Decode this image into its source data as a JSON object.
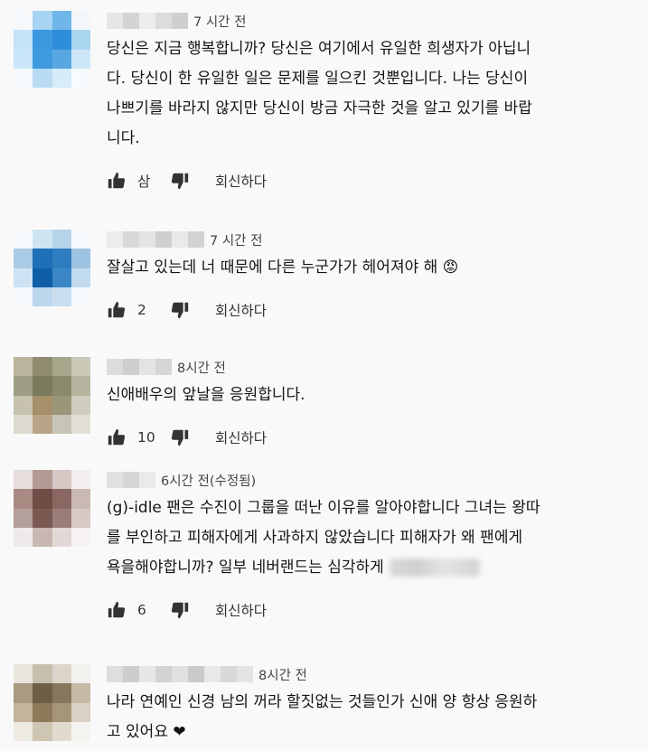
{
  "comments": [
    {
      "time": "7 시간 전",
      "lines": [
        "당신은 지금 행복합니까? 당신은 여기에서 유일한 희생자가 아닙니",
        "다. 당신이 한 유일한 일은 문제를 일으킨 것뿐입니다. 나는 당신이",
        "나쁘기를 바라지 않지만 당신이 방금 자극한 것을 알고 있기를 바랍",
        "니다."
      ],
      "likes": "삼",
      "reply": "회신하다",
      "avatar_colors": [
        "#f6f9fb",
        "#a6d4f2",
        "#6fb7e8",
        "#f3f7fa",
        "#c4e3f6",
        "#3b98de",
        "#2f8ed9",
        "#a9d5f1",
        "#c8e6f7",
        "#3f9be0",
        "#59a7e2",
        "#cde7f7",
        "#f7fafc",
        "#b9dcf3",
        "#d6ecf8",
        "#f8fbfd"
      ],
      "name_colors": [
        "#e6e6e6",
        "#d4d4d4",
        "#ececec",
        "#dcdcdc",
        "#cfcfcf"
      ]
    },
    {
      "time": "7 시간 전",
      "lines": [
        "잘살고 있는데 너 때문에 다른 누군가가 헤어져야 해 😡"
      ],
      "likes": "2",
      "reply": "회신하다",
      "avatar_colors": [
        "#f7fafc",
        "#cfe4f3",
        "#b6d4ea",
        "#f6f9fb",
        "#a9cbe6",
        "#1e70b8",
        "#2f7dc0",
        "#9dc3e3",
        "#cde2f2",
        "#0f5ea9",
        "#3a86c6",
        "#c2dbef",
        "#f6f9fc",
        "#bcd6ec",
        "#c9dff0",
        "#f7fafc"
      ],
      "name_colors": [
        "#ececec",
        "#d9d9d9",
        "#e4e4e4",
        "#cfcfcf",
        "#e9e9e9",
        "#d2d2d2"
      ]
    },
    {
      "time": "8시간 전",
      "lines": [
        "신애배우의 앞날을 응원합니다."
      ],
      "likes": "10",
      "reply": "회신하다",
      "avatar_colors": [
        "#b9b49c",
        "#8f8c72",
        "#a5a68a",
        "#c9c8b6",
        "#a09d85",
        "#7c7a5e",
        "#8b8a6f",
        "#b6b49e",
        "#c6c2ad",
        "#a59069",
        "#9a9679",
        "#cfcdbd",
        "#dcdad0",
        "#b8a486",
        "#c8c5b6",
        "#e1dfd6"
      ],
      "name_colors": [
        "#dcdcdc",
        "#cfcfcf",
        "#e3e3e3",
        "#d6d6d6"
      ]
    },
    {
      "time": "6시간 전(수정됨)",
      "lines": [
        "(g)-idle 팬은 수진이 그룹을 떠난 이유를 알아야합니다 그녀는 왕따",
        "를 부인하고 피해자에게 사과하지 않았습니다 피해자가 왜 팬에게",
        "욕을해야합니까? 일부 네버랜드는 심각하게"
      ],
      "blur_tail": true,
      "likes": "6",
      "reply": "회신하다",
      "avatar_colors": [
        "#e6dedc",
        "#b39a95",
        "#d4c7c4",
        "#f2eeed",
        "#a88a83",
        "#6e4d47",
        "#8a6861",
        "#c9b8b4",
        "#b59f9a",
        "#7a5953",
        "#9b7d77",
        "#d6c9c6",
        "#efeae9",
        "#c8b7b3",
        "#e2d8d6",
        "#f5f2f1"
      ],
      "name_colors": [
        "#e2e2e2",
        "#d6d6d6",
        "#eaeaea"
      ]
    },
    {
      "time": "8시간 전",
      "lines": [
        "나라 연예인 신경 남의 꺼라 할짓없는 것들인가 신애 양 항상 응원하",
        "고 있어요 ❤"
      ],
      "likes": "",
      "reply": "",
      "avatar_colors": [
        "#e9e6df",
        "#c7bfae",
        "#dcd6ca",
        "#f3f1ed",
        "#a99a80",
        "#6f5e45",
        "#87765c",
        "#c5baa6",
        "#c3b49b",
        "#8d7a5b",
        "#a69579",
        "#d9d1c3",
        "#eeebe5",
        "#cfc5b3",
        "#e1dbcf",
        "#f5f3ef"
      ],
      "name_colors": [
        "#dedede",
        "#cdcdcd",
        "#e7e7e7",
        "#d3d3d3",
        "#e0e0e0",
        "#cacaca",
        "#e8e8e8",
        "#d8d8d8",
        "#e4e4e4"
      ]
    }
  ]
}
